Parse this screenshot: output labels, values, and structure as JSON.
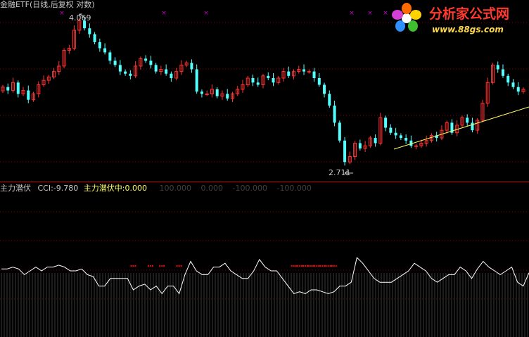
{
  "window": {
    "title": "金融ETF(日线,后复权 对数)"
  },
  "price_panel": {
    "high_label": "4.069",
    "low_label": "2.711"
  },
  "indicator_panel": {
    "name": "主力潜伏",
    "cci_label": "CCI:",
    "cci_value": "-9.780",
    "signal_label": "主力潜伏中:",
    "signal_value": "0.000",
    "ref_lines": [
      "100.000",
      "0.000",
      "-100.000",
      "-100.000"
    ]
  },
  "watermark": {
    "text": "分析家公式网",
    "url": "www.88gs.com"
  },
  "colors": {
    "up": "#ff3232",
    "down": "#54ffff",
    "trendline": "#ffff66",
    "cci_line": "#ffffff",
    "signal": "#ff0000",
    "grid": "#8b0000",
    "separator": "#c00000",
    "marker": "#c000c0"
  },
  "chart_data": [
    {
      "type": "candlestick",
      "title": "金融ETF(日线,后复权 对数)",
      "scale": "log",
      "annotations": [
        {
          "label": "4.069",
          "kind": "period-high"
        },
        {
          "label": "2.711",
          "kind": "period-low"
        }
      ],
      "close_series": [
        3.36,
        3.33,
        3.4,
        3.3,
        3.33,
        3.25,
        3.3,
        3.38,
        3.42,
        3.45,
        3.5,
        3.55,
        3.7,
        3.72,
        3.9,
        4.0,
        3.92,
        3.86,
        3.78,
        3.72,
        3.68,
        3.6,
        3.56,
        3.5,
        3.48,
        3.46,
        3.55,
        3.62,
        3.6,
        3.56,
        3.5,
        3.52,
        3.48,
        3.44,
        3.5,
        3.56,
        3.58,
        3.52,
        3.32,
        3.3,
        3.3,
        3.34,
        3.28,
        3.3,
        3.26,
        3.3,
        3.34,
        3.38,
        3.44,
        3.4,
        3.38,
        3.46,
        3.44,
        3.4,
        3.44,
        3.5,
        3.46,
        3.5,
        3.52,
        3.5,
        3.5,
        3.44,
        3.38,
        3.3,
        3.2,
        3.06,
        2.92,
        2.76,
        2.8,
        2.9,
        2.86,
        2.88,
        2.94,
        2.9,
        3.1,
        3.02,
        2.98,
        2.96,
        2.94,
        2.92,
        2.88,
        2.88,
        2.9,
        2.92,
        2.96,
        2.94,
        3.0,
        3.06,
        2.98,
        3.04,
        3.1,
        3.06,
        3.0,
        3.08,
        3.22,
        3.4,
        3.56,
        3.52,
        3.46,
        3.4,
        3.36,
        3.32,
        3.34
      ],
      "trendline": "rising support line under recent lows",
      "top_markers": 6
    },
    {
      "type": "line",
      "title": "主力潜伏",
      "series": [
        {
          "name": "CCI",
          "last_value": -9.78
        },
        {
          "name": "主力潜伏中",
          "last_value": 0.0
        }
      ],
      "ref_levels": [
        100,
        0,
        -100,
        -100
      ],
      "cci_values": [
        10,
        10,
        20,
        10,
        -20,
        0,
        20,
        0,
        20,
        20,
        30,
        20,
        0,
        0,
        10,
        -20,
        -30,
        -80,
        -80,
        -40,
        -40,
        -40,
        -40,
        -100,
        -80,
        -70,
        -100,
        -80,
        -120,
        -80,
        -80,
        -120,
        -20,
        50,
        0,
        -20,
        -20,
        20,
        20,
        40,
        0,
        -20,
        -40,
        -40,
        0,
        60,
        20,
        0,
        0,
        -40,
        -80,
        -120,
        -110,
        -120,
        -100,
        -100,
        -110,
        -120,
        -110,
        -80,
        -80,
        -60,
        70,
        40,
        0,
        -40,
        -60,
        -60,
        -60,
        -40,
        -20,
        0,
        40,
        20,
        0,
        -40,
        -60,
        -40,
        -20,
        -20,
        20,
        0,
        -40,
        10,
        50,
        20,
        0,
        -20,
        0,
        20,
        -60,
        -80,
        -10
      ]
    }
  ]
}
